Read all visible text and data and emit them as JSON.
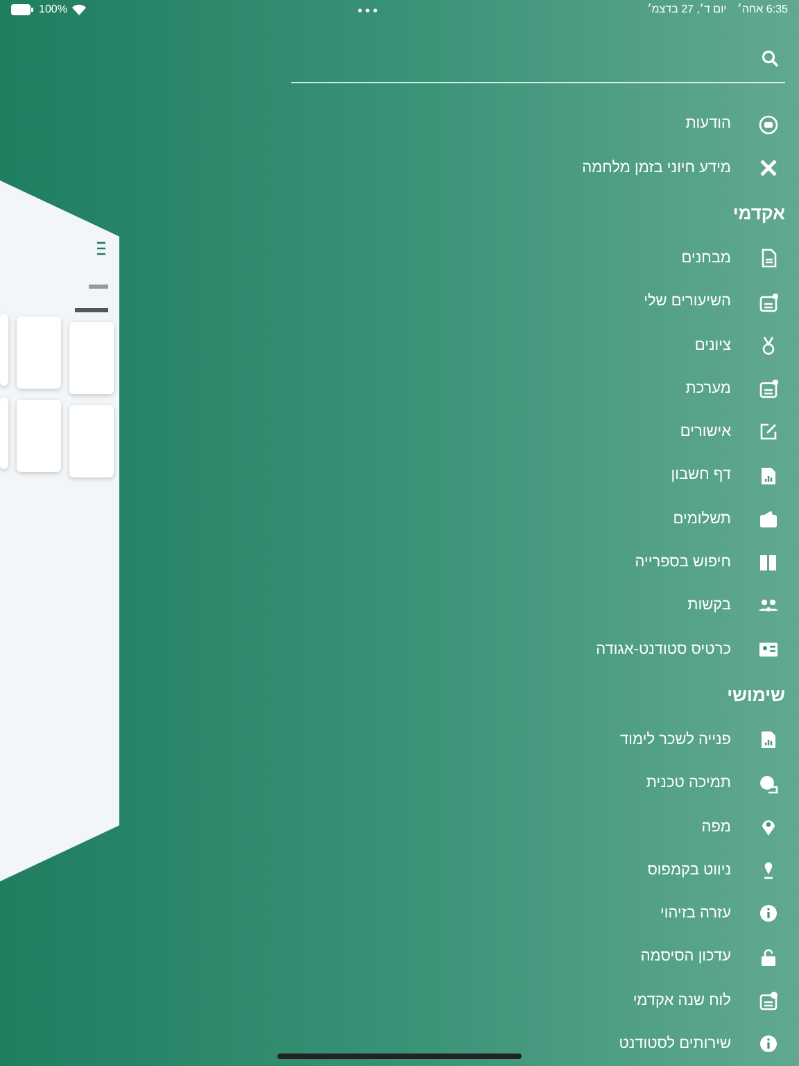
{
  "status_bar": {
    "battery": "100%",
    "time": "6:35 אחה׳",
    "date": "יום ד׳, 27 בדצמ׳"
  },
  "menu": [
    {
      "kind": "item",
      "label": "הודעות"
    },
    {
      "kind": "item",
      "label": "מידע חיוני בזמן מלחמה"
    },
    {
      "kind": "header",
      "label": "אקדמי"
    },
    {
      "kind": "item",
      "label": "מבחנים"
    },
    {
      "kind": "item",
      "label": "השיעורים שלי"
    },
    {
      "kind": "item",
      "label": "ציונים"
    },
    {
      "kind": "item",
      "label": "מערכת"
    },
    {
      "kind": "item",
      "label": "אישורים"
    },
    {
      "kind": "item",
      "label": "דף חשבון"
    },
    {
      "kind": "item",
      "label": "תשלומים"
    },
    {
      "kind": "item",
      "label": "חיפוש בספרייה"
    },
    {
      "kind": "item",
      "label": "בקשות"
    },
    {
      "kind": "item",
      "label": "כרטיס סטודנט-אגודה"
    },
    {
      "kind": "header",
      "label": "שימושי"
    },
    {
      "kind": "item",
      "label": "פנייה לשכר לימוד"
    },
    {
      "kind": "item",
      "label": "תמיכה טכנית"
    },
    {
      "kind": "item",
      "label": "מפה"
    },
    {
      "kind": "item",
      "label": "ניווט בקמפוס"
    },
    {
      "kind": "item",
      "label": "עזרה בזיהוי"
    },
    {
      "kind": "item",
      "label": "עדכון הסיסמה"
    },
    {
      "kind": "item",
      "label": "לוח שנה אקדמי"
    },
    {
      "kind": "item",
      "label": "שירותים לסטודנט"
    }
  ]
}
